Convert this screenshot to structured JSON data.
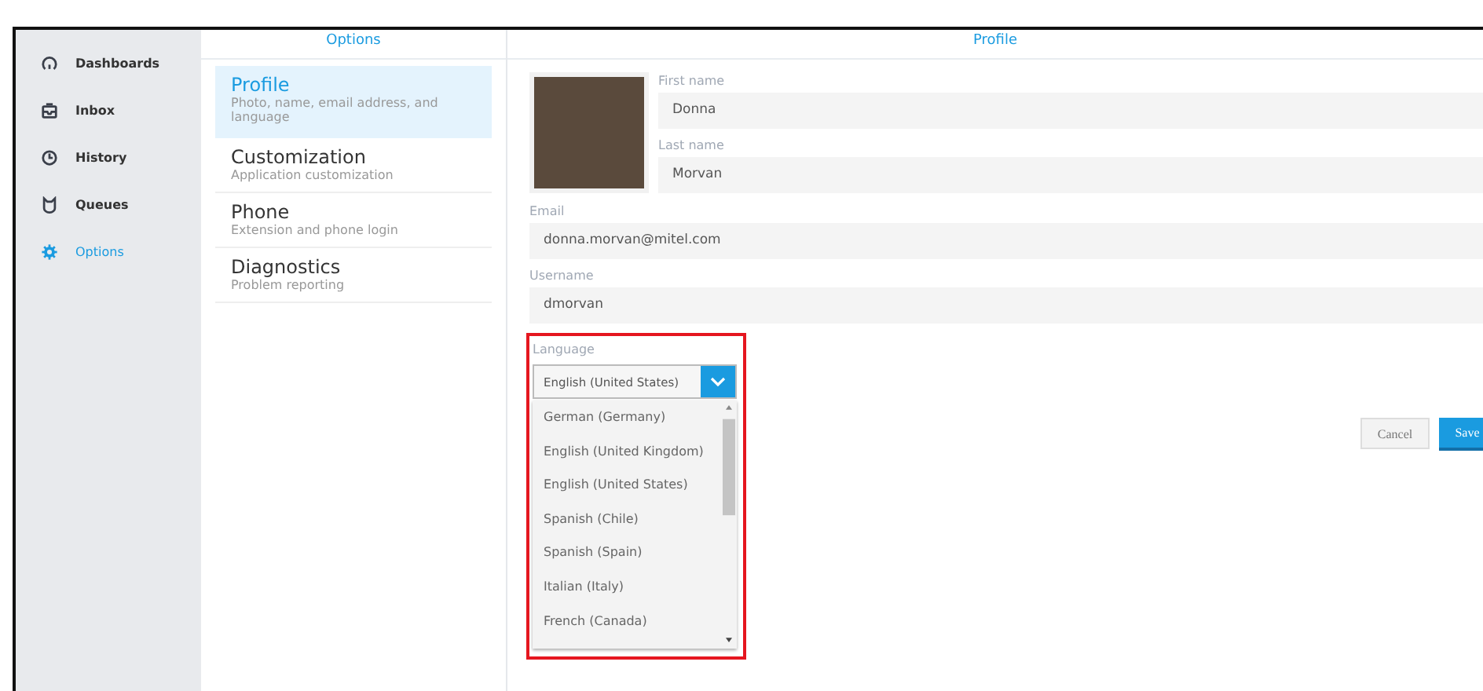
{
  "sidebar": {
    "items": [
      {
        "label": "Dashboards",
        "kind": "gauge",
        "selected": false
      },
      {
        "label": "Inbox",
        "kind": "inbox",
        "selected": false
      },
      {
        "label": "History",
        "kind": "clock",
        "selected": false
      },
      {
        "label": "Queues",
        "kind": "queue",
        "selected": false
      },
      {
        "label": "Options",
        "kind": "gear",
        "selected": true
      }
    ]
  },
  "options": {
    "title": "Options",
    "items": [
      {
        "title": "Profile",
        "subtitle": "Photo, name, email address, and language",
        "selected": true
      },
      {
        "title": "Customization",
        "subtitle": "Application customization",
        "selected": false
      },
      {
        "title": "Phone",
        "subtitle": "Extension and phone login",
        "selected": false
      },
      {
        "title": "Diagnostics",
        "subtitle": "Problem reporting",
        "selected": false
      }
    ]
  },
  "profile": {
    "title": "Profile",
    "first_name": {
      "label": "First name",
      "value": "Donna"
    },
    "last_name": {
      "label": "Last name",
      "value": "Morvan"
    },
    "email": {
      "label": "Email",
      "value": "donna.morvan@mitel.com"
    },
    "username": {
      "label": "Username",
      "value": "dmorvan"
    },
    "language": {
      "label": "Language",
      "value": "English (United States)",
      "highlighted": true,
      "expanded": true,
      "options": [
        "German (Germany)",
        "English (United Kingdom)",
        "English (United States)",
        "Spanish (Chile)",
        "Spanish (Spain)",
        "Italian (Italy)",
        "French (Canada)"
      ]
    },
    "buttons": {
      "cancel": "Cancel",
      "save": "Save"
    }
  }
}
